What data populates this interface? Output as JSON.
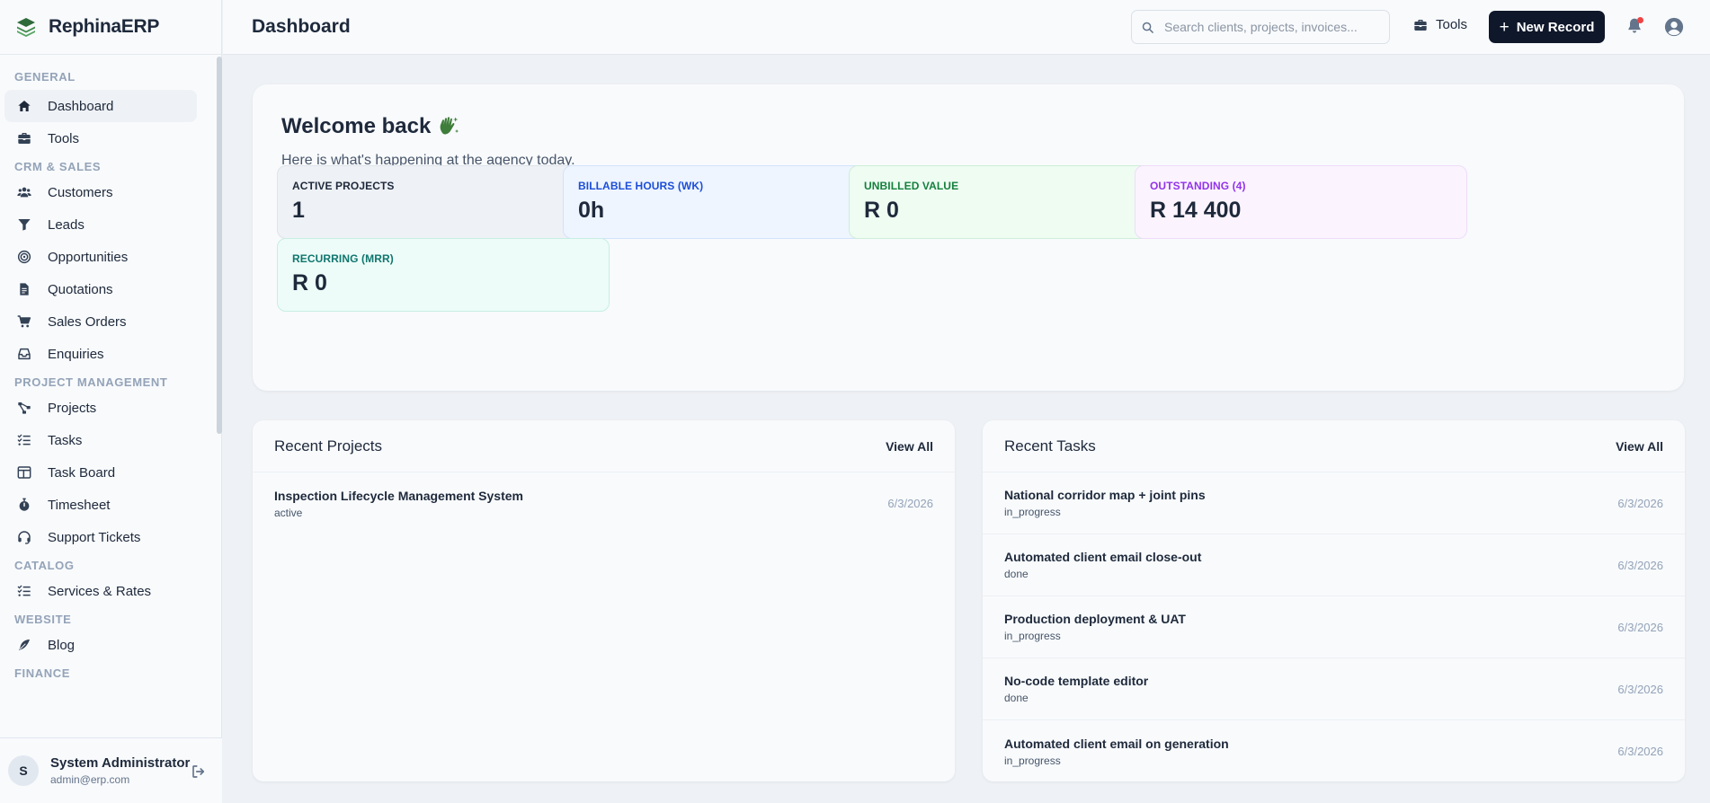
{
  "brand": {
    "name": "RephinaERP"
  },
  "sidebar": {
    "sections": [
      {
        "title": "General",
        "items": [
          {
            "label": "Dashboard",
            "icon": "home-icon",
            "active": true
          },
          {
            "label": "Tools",
            "icon": "toolbox-icon"
          }
        ]
      },
      {
        "title": "CRM & Sales",
        "items": [
          {
            "label": "Customers",
            "icon": "users-icon"
          },
          {
            "label": "Leads",
            "icon": "filter-icon"
          },
          {
            "label": "Opportunities",
            "icon": "target-icon"
          },
          {
            "label": "Quotations",
            "icon": "document-icon"
          },
          {
            "label": "Sales Orders",
            "icon": "cart-icon"
          },
          {
            "label": "Enquiries",
            "icon": "inbox-icon"
          }
        ]
      },
      {
        "title": "Project Management",
        "items": [
          {
            "label": "Projects",
            "icon": "diagram-icon"
          },
          {
            "label": "Tasks",
            "icon": "checklist-icon"
          },
          {
            "label": "Task Board",
            "icon": "board-icon"
          },
          {
            "label": "Timesheet",
            "icon": "stopwatch-icon"
          },
          {
            "label": "Support Tickets",
            "icon": "headset-icon"
          }
        ]
      },
      {
        "title": "Catalog",
        "items": [
          {
            "label": "Services & Rates",
            "icon": "checklist-icon"
          }
        ]
      },
      {
        "title": "Website",
        "items": [
          {
            "label": "Blog",
            "icon": "feather-icon"
          }
        ]
      },
      {
        "title": "Finance",
        "items": []
      }
    ]
  },
  "user": {
    "initial": "S",
    "name": "System Administrator",
    "email": "admin@erp.com"
  },
  "header": {
    "title": "Dashboard",
    "search_placeholder": "Search clients, projects, invoices...",
    "tools_label": "Tools",
    "new_record_label": "New Record"
  },
  "welcome": {
    "title": "Welcome back",
    "subtitle": "Here is what's happening at the agency today."
  },
  "stats": [
    {
      "label": "Active Projects",
      "value": "1",
      "color": "#1e293b",
      "bg": "#eef1f5",
      "border": "#dfe4ea"
    },
    {
      "label": "Billable Hours (Wk)",
      "value": "0h",
      "color": "#1d4ed8",
      "bg": "#eef5ff",
      "border": "#d3e3fb"
    },
    {
      "label": "Unbilled Value",
      "value": "R 0",
      "color": "#15803d",
      "bg": "#eefcf2",
      "border": "#cdeed9"
    },
    {
      "label": "Outstanding (4)",
      "value": "R 14 400",
      "color": "#9333ea",
      "bg": "#fbf4ff",
      "border": "#efdcfa"
    },
    {
      "label": "Recurring (MRR)",
      "value": "R 0",
      "color": "#0f766e",
      "bg": "#edfcf8",
      "border": "#c8eee3"
    }
  ],
  "recent_projects": {
    "title": "Recent Projects",
    "view_all": "View All",
    "rows": [
      {
        "title": "Inspection Lifecycle Management System",
        "status": "active",
        "date": "6/3/2026"
      }
    ]
  },
  "recent_tasks": {
    "title": "Recent Tasks",
    "view_all": "View All",
    "rows": [
      {
        "title": "National corridor map + joint pins",
        "status": "in_progress",
        "date": "6/3/2026"
      },
      {
        "title": "Automated client email close-out",
        "status": "done",
        "date": "6/3/2026"
      },
      {
        "title": "Production deployment & UAT",
        "status": "in_progress",
        "date": "6/3/2026"
      },
      {
        "title": "No-code template editor",
        "status": "done",
        "date": "6/3/2026"
      },
      {
        "title": "Automated client email on generation",
        "status": "in_progress",
        "date": "6/3/2026"
      }
    ]
  }
}
